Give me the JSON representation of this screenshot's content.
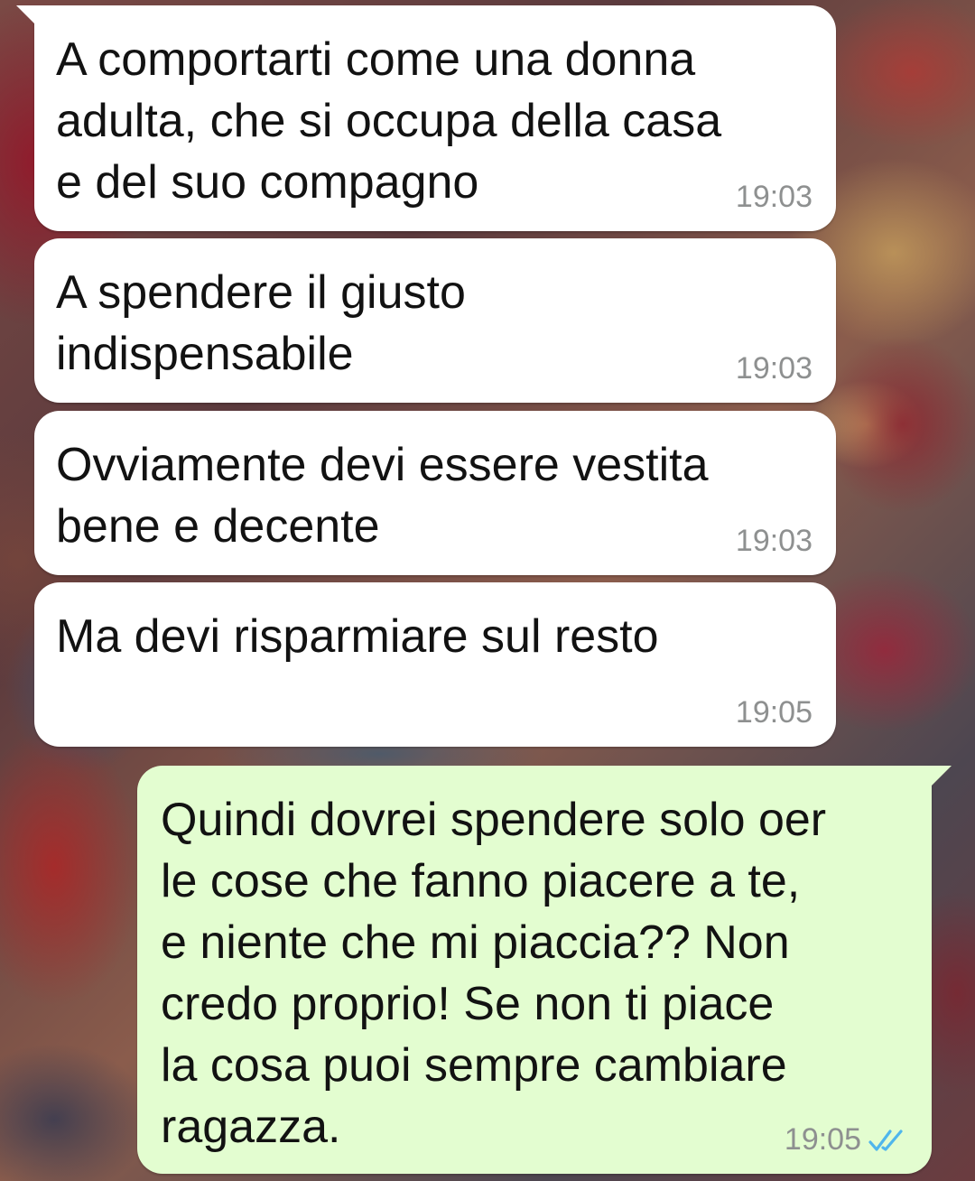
{
  "chat": {
    "messages": [
      {
        "direction": "incoming",
        "text": "A comportarti come una donna\nadulta, che si occupa della casa\ne del suo compagno",
        "time": "19:03"
      },
      {
        "direction": "incoming",
        "text": "A spendere il giusto\nindispensabile",
        "time": "19:03"
      },
      {
        "direction": "incoming",
        "text": "Ovviamente devi essere vestita\nbene e decente",
        "time": "19:03"
      },
      {
        "direction": "incoming",
        "text": "Ma devi risparmiare sul resto",
        "time": "19:05"
      },
      {
        "direction": "outgoing",
        "text": "Quindi dovrei spendere solo oer\nle cose che fanno piacere a te,\ne niente che mi piaccia?? Non\ncredo proprio! Se non ti piace\nla cosa puoi sempre cambiare\nragazza.",
        "time": "19:05",
        "status_icon": "double-check-read-icon"
      }
    ]
  },
  "colors": {
    "incoming_bubble": "#ffffff",
    "outgoing_bubble": "#e3fdd0",
    "timestamp": "#8e9090",
    "read_ticks": "#4fb6ec"
  }
}
